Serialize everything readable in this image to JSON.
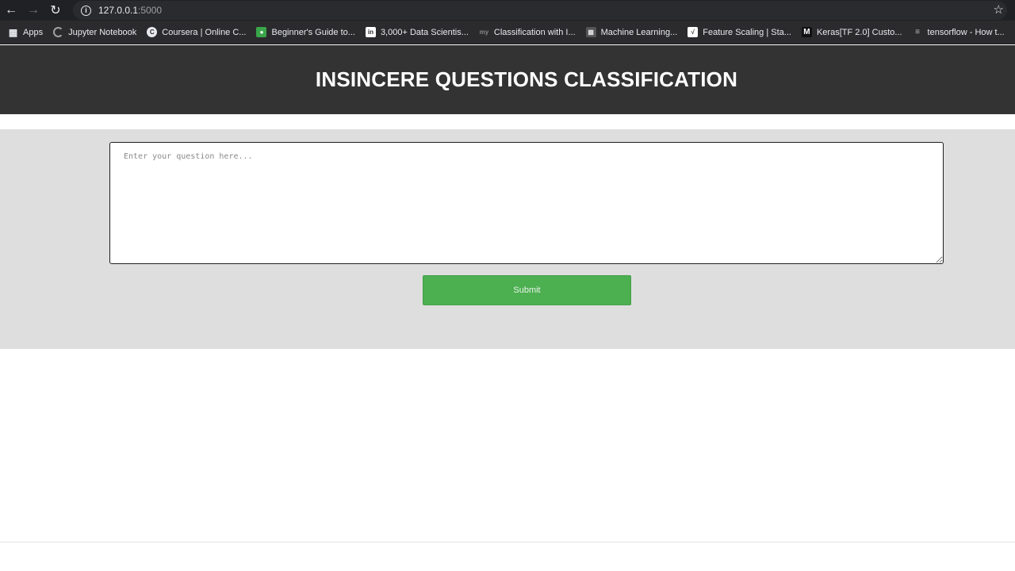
{
  "browser": {
    "url_host": "127.0.0.1",
    "url_port": ":5000",
    "bookmarks": [
      {
        "label": "Apps",
        "icon": "apps-grid-icon"
      },
      {
        "label": "Jupyter Notebook",
        "icon": "jupyter-icon"
      },
      {
        "label": "Coursera | Online C...",
        "icon": "coursera-icon"
      },
      {
        "label": "Beginner's Guide to...",
        "icon": "beginners-guide-icon"
      },
      {
        "label": "3,000+ Data Scientis...",
        "icon": "linkedin-icon"
      },
      {
        "label": "Classification with I...",
        "icon": "my-icon"
      },
      {
        "label": "Machine Learning...",
        "icon": "machine-learning-icon"
      },
      {
        "label": "Feature Scaling | Sta...",
        "icon": "feature-scaling-icon"
      },
      {
        "label": "Keras[TF 2.0] Custo...",
        "icon": "medium-icon"
      },
      {
        "label": "tensorflow - How t...",
        "icon": "stackoverflow-icon"
      }
    ]
  },
  "page": {
    "title": "INSINCERE QUESTIONS CLASSIFICATION",
    "question_placeholder": "Enter your question here...",
    "submit_label": "Submit"
  },
  "colors": {
    "header_bg": "#333333",
    "panel_bg": "#dedede",
    "submit_bg": "#4caf50"
  }
}
